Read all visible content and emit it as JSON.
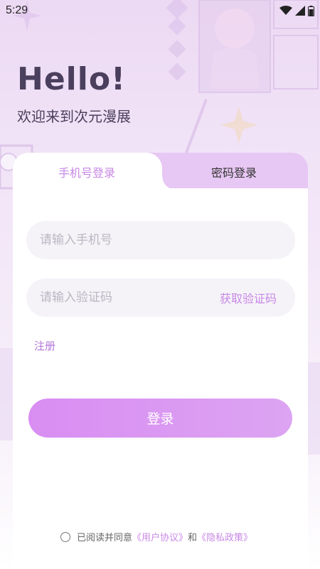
{
  "status_bar": {
    "time": "5:29",
    "icons": [
      "wifi-icon",
      "signal-icon",
      "battery-icon"
    ]
  },
  "header": {
    "title": "Hello!",
    "subtitle": "欢迎来到次元漫展"
  },
  "tabs": [
    {
      "label": "手机号登录",
      "active": true
    },
    {
      "label": "密码登录",
      "active": false
    }
  ],
  "form": {
    "phone_placeholder": "请输入手机号",
    "phone_value": "",
    "code_placeholder": "请输入验证码",
    "code_value": "",
    "get_code_label": "获取验证码",
    "register_label": "注册",
    "login_label": "登录"
  },
  "agreement": {
    "prefix": "已阅读并同意",
    "user_agreement": "《用户协议》",
    "and": "和",
    "privacy_policy": "《隐私政策》"
  },
  "colors": {
    "accent": "#c888e5",
    "button_start": "#d98df2",
    "button_end": "#dca4f2",
    "title": "#4a3f5c",
    "tab_inactive": "#e7c7f3"
  }
}
